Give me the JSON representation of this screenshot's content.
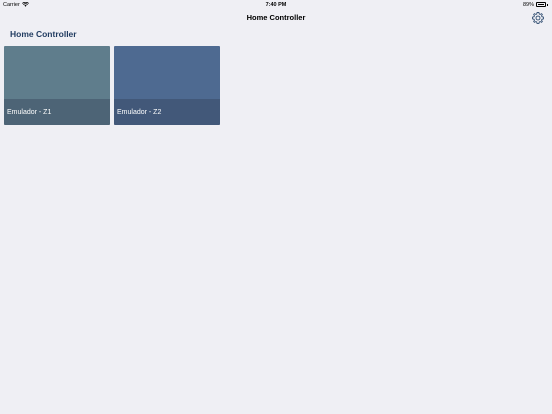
{
  "status_bar": {
    "carrier": "Carrier",
    "time": "7:40 PM",
    "battery_text": "89%",
    "battery_level": 0.89
  },
  "nav": {
    "title": "Home Controller",
    "settings_icon": "gear-icon"
  },
  "section": {
    "title": "Home Controller"
  },
  "tiles": [
    {
      "label": "Emulador - Z1",
      "color": "#5f7d8c"
    },
    {
      "label": "Emulador - Z2",
      "color": "#4e6a91"
    }
  ],
  "colors": {
    "background": "#efeff4",
    "accent": "#1f3a5f"
  }
}
